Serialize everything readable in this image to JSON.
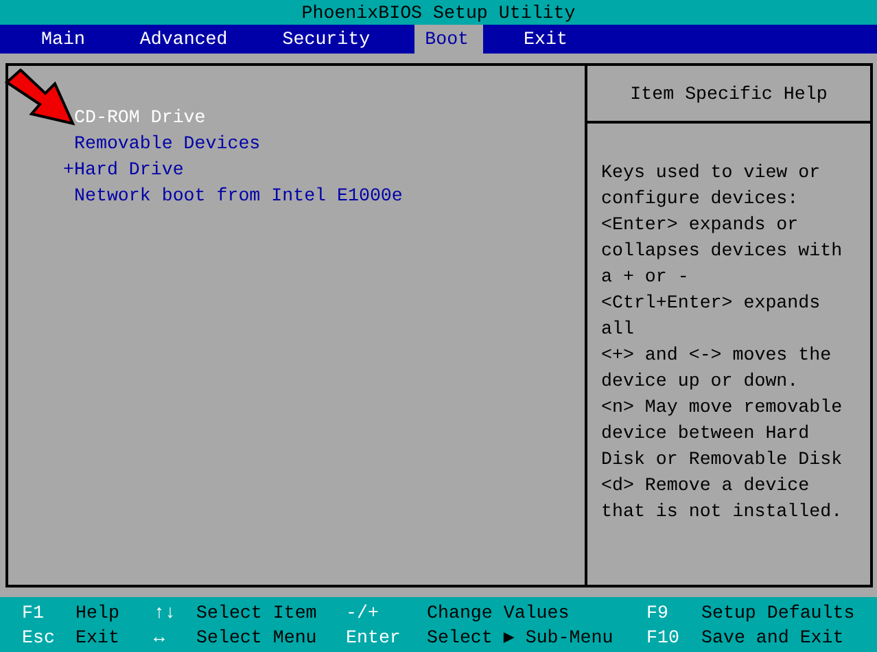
{
  "window": {
    "title": "PhoenixBIOS Setup Utility"
  },
  "tabs": [
    {
      "label": "Main",
      "selected": false
    },
    {
      "label": "Advanced",
      "selected": false
    },
    {
      "label": "Security",
      "selected": false
    },
    {
      "label": "Boot",
      "selected": true
    },
    {
      "label": "Exit",
      "selected": false
    }
  ],
  "boot_order": [
    {
      "label": "CD-ROM Drive",
      "selected": true
    },
    {
      "label": "Removable Devices",
      "selected": false
    },
    {
      "prefix": "+",
      "label": "Hard Drive",
      "selected": false
    },
    {
      "label": "Network boot from Intel E1000e",
      "selected": false
    }
  ],
  "annotation": {
    "kind": "arrow"
  },
  "help": {
    "title": "Item Specific Help",
    "lines": [
      "Keys used to view or",
      "configure devices:",
      "<Enter> expands or",
      "collapses devices with",
      "a + or -",
      "<Ctrl+Enter> expands",
      "all",
      "<+> and <-> moves the",
      "device up or down.",
      "<n> May move removable",
      "device between Hard",
      "Disk or Removable Disk",
      "<d> Remove a device",
      "that is not installed."
    ]
  },
  "footer": [
    {
      "key": "F1",
      "action": "Help"
    },
    {
      "key": "↑↓",
      "action": "Select Item"
    },
    {
      "key": "-/+",
      "action": "Change Values"
    },
    {
      "key": "F9",
      "action": "Setup Defaults"
    },
    {
      "key": "Esc",
      "action": "Exit"
    },
    {
      "key": "↔",
      "action": "Select Menu"
    },
    {
      "key": "Enter",
      "action": "Select ▶ Sub-Menu"
    },
    {
      "key": "F10",
      "action": "Save and Exit"
    }
  ]
}
